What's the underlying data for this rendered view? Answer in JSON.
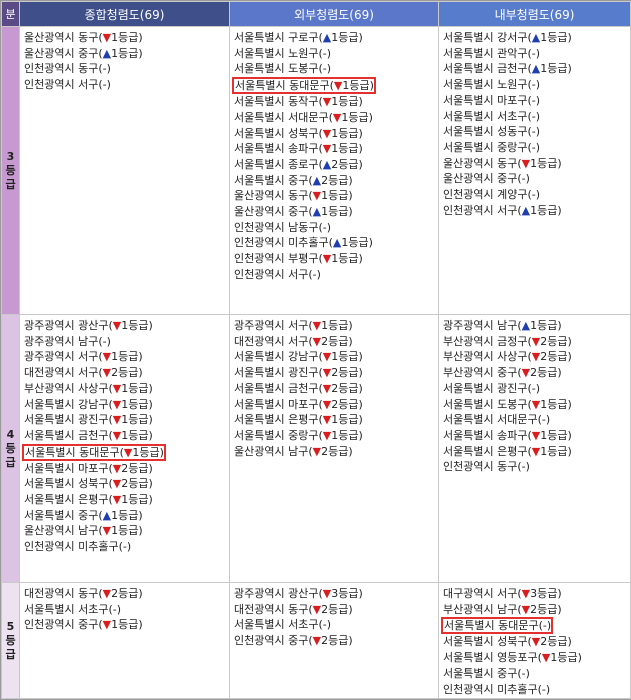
{
  "header": {
    "level": "분",
    "col1": "종합청렴도(69)",
    "col2": "외부청렴도(69)",
    "col3": "내부청렴도(69)"
  },
  "colors": {
    "down": "#d81e1e",
    "up": "#1f3fb0",
    "highlight": "#e53030"
  },
  "rows": [
    {
      "level": "3\n등급",
      "col1": [
        {
          "text": "울산광역시 동구(",
          "mark": "down",
          "suffix": "1등급)"
        },
        {
          "text": "울산광역시 중구(",
          "mark": "up",
          "suffix": "1등급)"
        },
        {
          "text": "인천광역시 동구(-)"
        },
        {
          "text": "인천광역시 서구(-)"
        }
      ],
      "col2": [
        {
          "text": "서울특별시 구로구(",
          "mark": "up",
          "suffix": "1등급)"
        },
        {
          "text": "서울특별시 노원구(-)"
        },
        {
          "text": "서울특별시 도봉구(-)"
        },
        {
          "text": "서울특별시 동대문구(",
          "mark": "down",
          "suffix": "1등급)",
          "hl": true
        },
        {
          "text": "서울특별시 동작구(",
          "mark": "down",
          "suffix": "1등급)"
        },
        {
          "text": "서울특별시 서대문구(",
          "mark": "down",
          "suffix": "1등급)"
        },
        {
          "text": "서울특별시 성북구(",
          "mark": "down",
          "suffix": "1등급)"
        },
        {
          "text": "서울특별시 송파구(",
          "mark": "down",
          "suffix": "1등급)"
        },
        {
          "text": "서울특별시 종로구(",
          "mark": "up",
          "suffix": "2등급)"
        },
        {
          "text": "서울특별시 중구(",
          "mark": "up",
          "suffix": "2등급)"
        },
        {
          "text": "울산광역시 동구(",
          "mark": "down",
          "suffix": "1등급)"
        },
        {
          "text": "울산광역시 중구(",
          "mark": "up",
          "suffix": "1등급)"
        },
        {
          "text": "인천광역시 남동구(-)"
        },
        {
          "text": "인천광역시 미추홀구(",
          "mark": "up",
          "suffix": "1등급)"
        },
        {
          "text": "인천광역시 부평구(",
          "mark": "down",
          "suffix": "1등급)"
        },
        {
          "text": "인천광역시 서구(-)"
        }
      ],
      "col3": [
        {
          "text": "서울특별시 강서구(",
          "mark": "up",
          "suffix": "1등급)"
        },
        {
          "text": "서울특별시 관악구(-)"
        },
        {
          "text": "서울특별시 금천구(",
          "mark": "up",
          "suffix": "1등급)"
        },
        {
          "text": "서울특별시 노원구(-)"
        },
        {
          "text": "서울특별시 마포구(-)"
        },
        {
          "text": "서울특별시 서초구(-)"
        },
        {
          "text": "서울특별시 성동구(-)"
        },
        {
          "text": "서울특별시 중랑구(-)"
        },
        {
          "text": "울산광역시 동구(",
          "mark": "down",
          "suffix": "1등급)"
        },
        {
          "text": "울산광역시 중구(-)"
        },
        {
          "text": "인천광역시 계양구(-)"
        },
        {
          "text": "인천광역시 서구(",
          "mark": "up",
          "suffix": "1등급)"
        }
      ]
    },
    {
      "level": "4\n등급",
      "col1": [
        {
          "text": "광주광역시 광산구(",
          "mark": "down",
          "suffix": "1등급)"
        },
        {
          "text": "광주광역시 남구(-)"
        },
        {
          "text": "광주광역시 서구(",
          "mark": "down",
          "suffix": "1등급)"
        },
        {
          "text": "대전광역시 서구(",
          "mark": "down",
          "suffix": "2등급)"
        },
        {
          "text": "부산광역시 사상구(",
          "mark": "down",
          "suffix": "1등급)"
        },
        {
          "text": "서울특별시 강남구(",
          "mark": "down",
          "suffix": "1등급)"
        },
        {
          "text": "서울특별시 광진구(",
          "mark": "down",
          "suffix": "1등급)"
        },
        {
          "text": "서울특별시 금천구(",
          "mark": "down",
          "suffix": "1등급)"
        },
        {
          "text": "서울특별시 동대문구(",
          "mark": "down",
          "suffix": "1등급)",
          "hl": true
        },
        {
          "text": "서울특별시 마포구(",
          "mark": "down",
          "suffix": "2등급)"
        },
        {
          "text": "서울특별시 성북구(",
          "mark": "down",
          "suffix": "2등급)"
        },
        {
          "text": "서울특별시 은평구(",
          "mark": "down",
          "suffix": "1등급)"
        },
        {
          "text": "서울특별시 중구(",
          "mark": "up",
          "suffix": "1등급)"
        },
        {
          "text": "울산광역시 남구(",
          "mark": "down",
          "suffix": "1등급)"
        },
        {
          "text": "인천광역시 미추홀구(-)"
        }
      ],
      "col2": [
        {
          "text": "광주광역시 서구(",
          "mark": "down",
          "suffix": "1등급)"
        },
        {
          "text": "대전광역시 서구(",
          "mark": "down",
          "suffix": "2등급)"
        },
        {
          "text": "서울특별시 강남구(",
          "mark": "down",
          "suffix": "1등급)"
        },
        {
          "text": "서울특별시 광진구(",
          "mark": "down",
          "suffix": "2등급)"
        },
        {
          "text": "서울특별시 금천구(",
          "mark": "down",
          "suffix": "2등급)"
        },
        {
          "text": "서울특별시 마포구(",
          "mark": "down",
          "suffix": "2등급)"
        },
        {
          "text": "서울특별시 은평구(",
          "mark": "down",
          "suffix": "1등급)"
        },
        {
          "text": "서울특별시 중랑구(",
          "mark": "down",
          "suffix": "1등급)"
        },
        {
          "text": "울산광역시 남구(",
          "mark": "down",
          "suffix": "2등급)"
        }
      ],
      "col3": [
        {
          "text": "광주광역시 남구(",
          "mark": "up",
          "suffix": "1등급)"
        },
        {
          "text": "부산광역시 금정구(",
          "mark": "down",
          "suffix": "2등급)"
        },
        {
          "text": "부산광역시 사상구(",
          "mark": "down",
          "suffix": "2등급)"
        },
        {
          "text": "부산광역시 중구(",
          "mark": "down",
          "suffix": "2등급)"
        },
        {
          "text": "서울특별시 광진구(-)"
        },
        {
          "text": "서울특별시 도봉구(",
          "mark": "down",
          "suffix": "1등급)"
        },
        {
          "text": "서울특별시 서대문구(-)"
        },
        {
          "text": "서울특별시 송파구(",
          "mark": "down",
          "suffix": "1등급)"
        },
        {
          "text": "서울특별시 은평구(",
          "mark": "down",
          "suffix": "1등급)"
        },
        {
          "text": "인천광역시 동구(-)"
        }
      ]
    },
    {
      "level": "5\n등급",
      "col1": [
        {
          "text": "대전광역시 동구(",
          "mark": "down",
          "suffix": "2등급)"
        },
        {
          "text": "서울특별시 서초구(-)"
        },
        {
          "text": "인천광역시 중구(",
          "mark": "down",
          "suffix": "1등급)"
        }
      ],
      "col2": [
        {
          "text": "광주광역시 광산구(",
          "mark": "down",
          "suffix": "3등급)"
        },
        {
          "text": "대전광역시 동구(",
          "mark": "down",
          "suffix": "2등급)"
        },
        {
          "text": "서울특별시 서초구(-)"
        },
        {
          "text": "인천광역시 중구(",
          "mark": "down",
          "suffix": "2등급)"
        }
      ],
      "col3": [
        {
          "text": "대구광역시 서구(",
          "mark": "down",
          "suffix": "3등급)"
        },
        {
          "text": "부산광역시 남구(",
          "mark": "down",
          "suffix": "2등급)"
        },
        {
          "text": "서울특별시 동대문구(-)",
          "hl": true
        },
        {
          "text": "서울특별시 성북구(",
          "mark": "down",
          "suffix": "2등급)"
        },
        {
          "text": "서울특별시 영등포구(",
          "mark": "down",
          "suffix": "1등급)"
        },
        {
          "text": "서울특별시 중구(-)"
        },
        {
          "text": "인천광역시 미추홀구(-)"
        }
      ]
    }
  ]
}
